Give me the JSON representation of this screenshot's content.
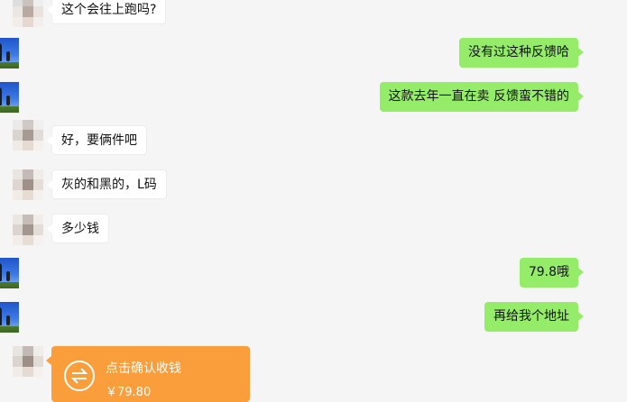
{
  "messages": [
    {
      "side": "left",
      "text": "这个会往上跑吗?"
    },
    {
      "side": "right",
      "text": "没有过这种反馈哈"
    },
    {
      "side": "right",
      "text": "这款去年一直在卖  反馈蛮不错的"
    },
    {
      "side": "left",
      "text": "好，要俩件吧"
    },
    {
      "side": "left",
      "text": "灰的和黑的，L码"
    },
    {
      "side": "left",
      "text": "多少钱"
    },
    {
      "side": "right",
      "text": "79.8哦"
    },
    {
      "side": "right",
      "text": "再给我个地址"
    }
  ],
  "transfer": {
    "title": "点击确认收钱",
    "amount": "￥79.80",
    "icon": "transfer-arrows-icon",
    "color": "#fa9d3b"
  },
  "colors": {
    "self_bubble": "#95ec69",
    "other_bubble": "#ffffff",
    "background": "#f5f5f5"
  }
}
